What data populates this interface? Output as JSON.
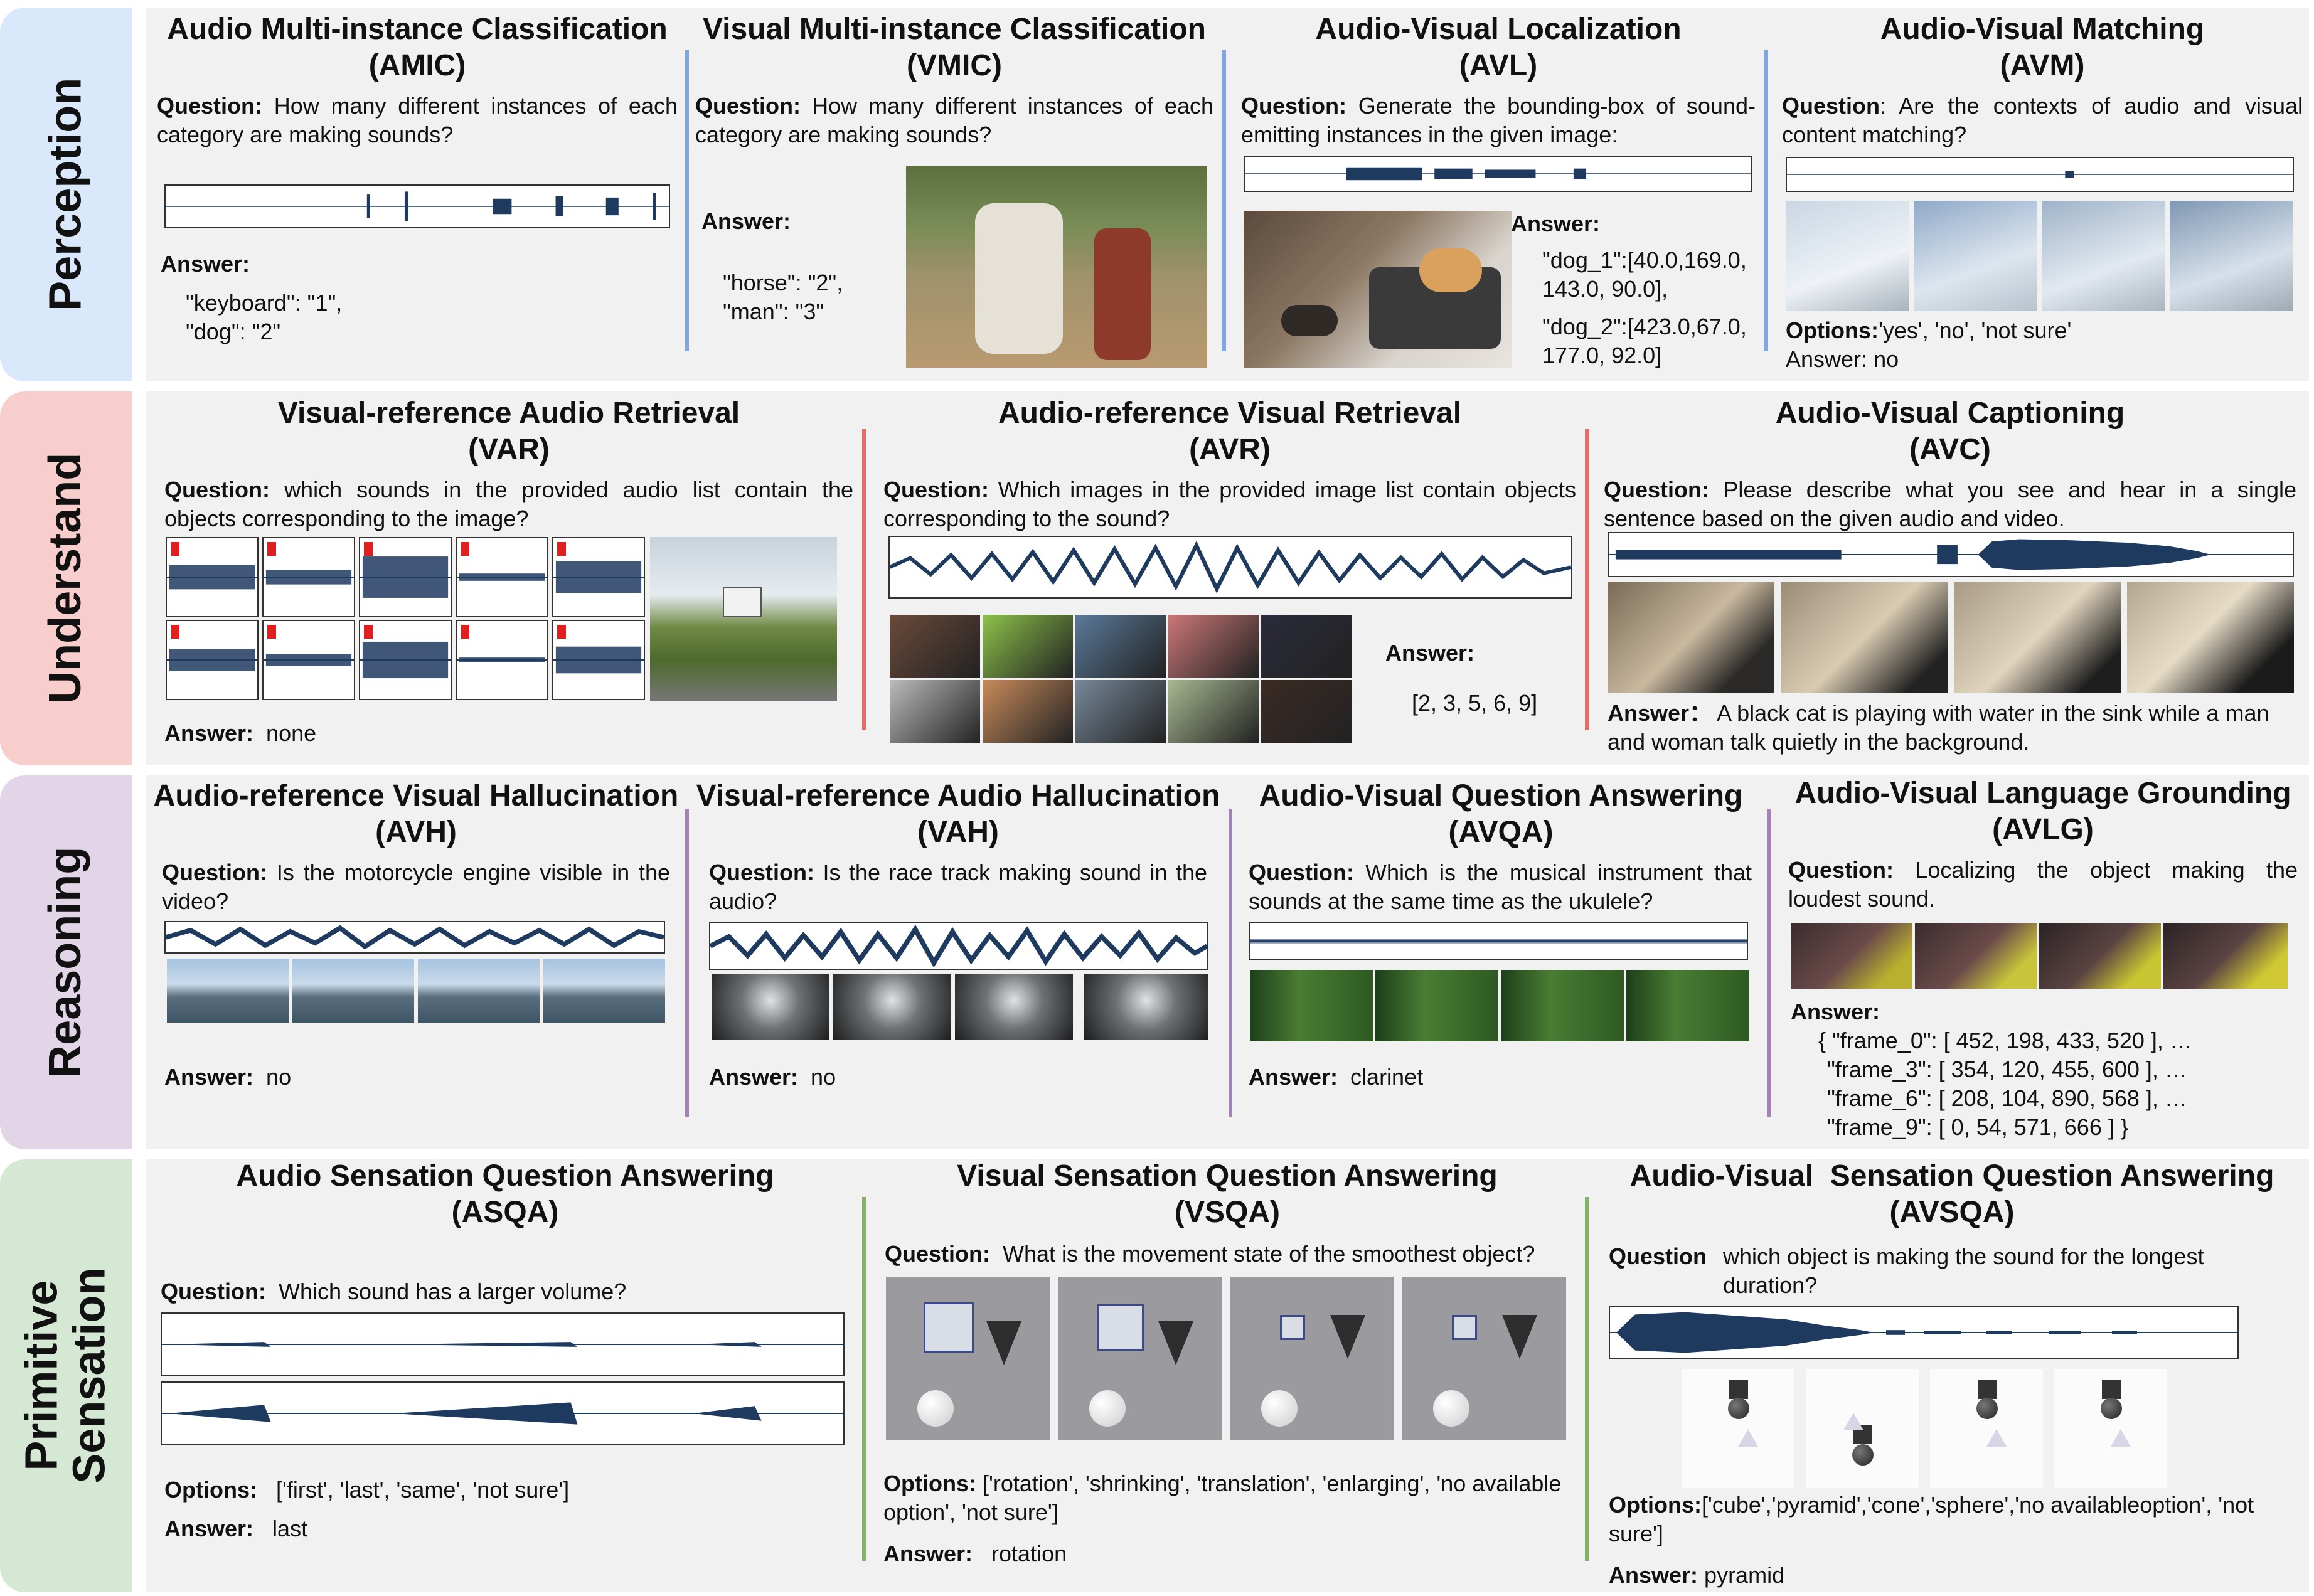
{
  "sections": [
    {
      "label": "Perception",
      "color": "#dae8fc"
    },
    {
      "label": "Understand",
      "color": "#f8cecc"
    },
    {
      "label": "Reasoning",
      "color": "#e1d5e7"
    },
    {
      "label": "Primitive\nSensation",
      "color": "#d5e8d4"
    }
  ],
  "colors": {
    "band_bg": "#f1f1f1",
    "perception_line": "#7ea6e0",
    "understand_line": "#ea6b66",
    "reasoning_line": "#a680b8",
    "sensation_line": "#82b366",
    "wave": "#1f3a5f"
  },
  "amic": {
    "title": "Audio Multi-instance Classification",
    "abbr": "(AMIC)",
    "q_label": "Question:",
    "question": "How many different instances of each category are making sounds?",
    "a_label": "Answer:",
    "answer_lines": [
      "\"keyboard\": \"1\",",
      "\"dog\": \"2\""
    ]
  },
  "vmic": {
    "title": "Visual Multi-instance Classification",
    "abbr": "(VMIC)",
    "q_label": "Question:",
    "question": "How many different instances of each category are making sounds?",
    "a_label": "Answer:",
    "answer_lines": [
      "\"horse\": \"2\",",
      "\"man\": \"3\""
    ]
  },
  "avl": {
    "title": "Audio-Visual Localization",
    "abbr": "(AVL)",
    "q_label": "Question:",
    "question": "Generate the bounding-box of sound-emitting instances in the given image:",
    "a_label": "Answer:",
    "answer_lines": [
      "\"dog_1\":[40.0,169.0,",
      "143.0, 90.0],",
      "\"dog_2\":[423.0,67.0,",
      "177.0, 92.0]"
    ]
  },
  "avm": {
    "title": "Audio-Visual Matching",
    "abbr": "(AVM)",
    "q_label": "Question",
    "question": ": Are the contexts of audio and visual content matching?",
    "o_label": "Options:",
    "options": "'yes', 'no', 'not sure'",
    "a_label": "Answer:",
    "answer": "no"
  },
  "var": {
    "title": "Visual-reference Audio Retrieval",
    "abbr": "(VAR)",
    "q_label": "Question:",
    "question": "which sounds in the provided audio list contain the objects corresponding to the image?",
    "a_label": "Answer:",
    "answer": "none"
  },
  "avr": {
    "title": "Audio-reference Visual Retrieval",
    "abbr": "(AVR)",
    "q_label": "Question:",
    "question": "Which images in the provided image list contain objects corresponding to the sound?",
    "a_label": "Answer:",
    "answer": "[2, 3, 5, 6, 9]"
  },
  "avc": {
    "title": "Audio-Visual Captioning",
    "abbr": "(AVC)",
    "q_label": "Question:",
    "question": "Please describe what you see and hear in a single sentence based on the given audio and video.",
    "a_label": "Answer：",
    "answer": "A black cat is playing with water in the sink while a man and woman talk quietly in the background."
  },
  "avh": {
    "title": "Audio-reference Visual Hallucination",
    "abbr": "(AVH)",
    "q_label": "Question:",
    "question": "Is the motorcycle engine visible in the video?",
    "a_label": "Answer:",
    "answer": "no"
  },
  "vah": {
    "title": "Visual-reference Audio Hallucination",
    "abbr": "(VAH)",
    "q_label": "Question:",
    "question": "Is the race track making sound in the audio?",
    "a_label": "Answer:",
    "answer": "no"
  },
  "avqa": {
    "title": "Audio-Visual Question Answering",
    "abbr": "(AVQA)",
    "q_label": "Question:",
    "question": "Which is the musical instrument that sounds at the same time as the ukulele?",
    "a_label": "Answer:",
    "answer": "clarinet"
  },
  "avlg": {
    "title": "Audio-Visual Language Grounding",
    "abbr": "(AVLG)",
    "q_label": "Question:",
    "question": "Localizing the object making the loudest sound.",
    "a_label": "Answer:",
    "answer_lines": [
      "{ \"frame_0\": [ 452, 198, 433, 520 ], …",
      "\"frame_3\": [ 354, 120, 455, 600 ], …",
      "\"frame_6\": [ 208, 104, 890, 568 ], …",
      "\"frame_9\": [ 0, 54, 571, 666 ] }"
    ]
  },
  "asqa": {
    "title": "Audio Sensation Question Answering",
    "abbr": "(ASQA)",
    "q_label": "Question:",
    "question": "Which sound has a larger volume?",
    "o_label": "Options:",
    "options": "['first', 'last', 'same', 'not sure']",
    "a_label": "Answer:",
    "answer": "last"
  },
  "vsqa": {
    "title": "Visual Sensation Question Answering",
    "abbr": "(VSQA)",
    "q_label": "Question:",
    "question": "What is the movement state of the smoothest object?",
    "o_label": "Options:",
    "options": "['rotation', 'shrinking', 'translation', 'enlarging', 'no available option', 'not sure']",
    "a_label": "Answer:",
    "answer": "rotation"
  },
  "avsqa": {
    "title": "Audio-Visual  Sensation Question Answering",
    "abbr": "(AVSQA)",
    "q_label": "Question",
    "question": "which object is making the sound for the longest duration?",
    "o_label": "Options:",
    "options": "['cube','pyramid','cone','sphere','no availableoption', 'not sure']",
    "a_label": "Answer:",
    "answer": "pyramid"
  }
}
